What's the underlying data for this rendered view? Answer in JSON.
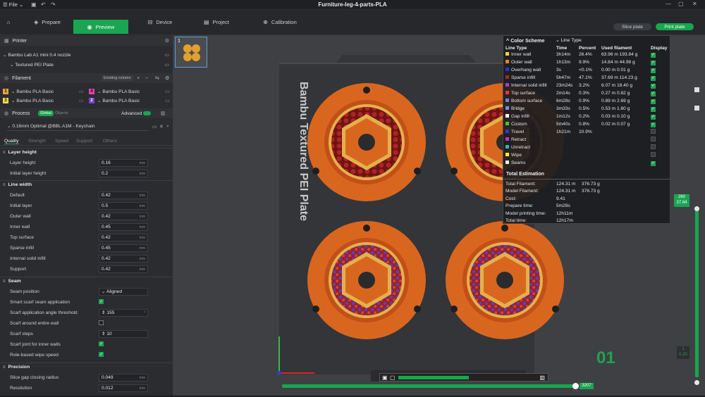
{
  "titlebar": {
    "menu": "☰ File ⌄",
    "title": "Furniture-leg-4-parts-PLA",
    "win_min": "—",
    "win_max": "▢",
    "win_close": "✕"
  },
  "nav": {
    "tabs": [
      {
        "label": "Prepare",
        "icon": "cube-icon"
      },
      {
        "label": "Preview",
        "icon": "eye-icon"
      },
      {
        "label": "Device",
        "icon": "device-icon"
      },
      {
        "label": "Project",
        "icon": "folder-icon"
      },
      {
        "label": "Calibration",
        "icon": "calibration-icon"
      }
    ],
    "slice_btn": "Slice plate",
    "print_btn": "Print plate"
  },
  "printer": {
    "section": "Printer",
    "name": "Bambu Lab A1 mini 0.4 nozzle",
    "plate": "Textured PEI Plate"
  },
  "filament": {
    "section": "Filament",
    "existing_btn": "Existing column",
    "items": [
      {
        "num": "1",
        "name": "Bambu PLA Basic",
        "color": "#e8a23a"
      },
      {
        "num": "2",
        "name": "Bambu PLA Basic",
        "color": "#7a3fd0"
      },
      {
        "num": "3",
        "name": "Bambu PLA Basic",
        "color": "#f5d642"
      },
      {
        "num": "4",
        "name": "Bambu PLA Basic",
        "color": "#e83ea6"
      }
    ]
  },
  "process": {
    "section": "Process",
    "global": "Global",
    "objects": "Objects",
    "advanced": "Advanced",
    "preset": "0.16mm Optimal @BBL A1M - Keychain",
    "tabs": [
      "Quality",
      "Strength",
      "Speed",
      "Support",
      "Others"
    ]
  },
  "settings": {
    "layer_height": {
      "title": "Layer height",
      "rows": [
        {
          "label": "Layer height",
          "value": "0.16",
          "unit": "mm"
        },
        {
          "label": "Initial layer height",
          "value": "0.2",
          "unit": "mm"
        }
      ]
    },
    "line_width": {
      "title": "Line width",
      "rows": [
        {
          "label": "Default",
          "value": "0.42",
          "unit": "mm"
        },
        {
          "label": "Initial layer",
          "value": "0.5",
          "unit": "mm"
        },
        {
          "label": "Outer wall",
          "value": "0.42",
          "unit": "mm"
        },
        {
          "label": "Inner wall",
          "value": "0.45",
          "unit": "mm"
        },
        {
          "label": "Top surface",
          "value": "0.42",
          "unit": "mm"
        },
        {
          "label": "Sparse infill",
          "value": "0.45",
          "unit": "mm"
        },
        {
          "label": "Internal solid infill",
          "value": "0.42",
          "unit": "mm"
        },
        {
          "label": "Support",
          "value": "0.42",
          "unit": "mm"
        }
      ]
    },
    "seam": {
      "title": "Seam",
      "position_label": "Seam position",
      "position_value": "Aligned",
      "smart_label": "Smart scarf seam application",
      "angle_label": "Scarf application angle threshold",
      "angle_value": "155",
      "angle_unit": "°",
      "entire_label": "Scarf around entire wall",
      "steps_label": "Scarf steps",
      "steps_value": "10",
      "inner_label": "Scarf joint for inner walls",
      "role_label": "Role-based wipe speed"
    },
    "precision": {
      "title": "Precision",
      "rows": [
        {
          "label": "Slice gap closing radius",
          "value": "0.049",
          "unit": "mm"
        },
        {
          "label": "Resolution",
          "value": "0.012",
          "unit": "mm"
        }
      ]
    }
  },
  "canvas": {
    "plate_text": "Bambu Textured PEI Plate",
    "plate_num": "01",
    "thumb_num": "1",
    "layer_top_1": "260",
    "layer_top_2": "37.64",
    "layer_bottom_1": "1",
    "layer_bottom_2": "0.20",
    "progress_label": "3207"
  },
  "color_scheme": {
    "title": "Color Scheme",
    "mode": "Line Type",
    "headers": [
      "Line Type",
      "Time",
      "Percent",
      "Used filament",
      "Display"
    ],
    "rows": [
      {
        "color": "#f5d23a",
        "name": "Inner wall",
        "time": "3h14m",
        "percent": "26.4%",
        "len": "63.96 m",
        "weight": "193.84 g",
        "display": true
      },
      {
        "color": "#ee7d2a",
        "name": "Outer wall",
        "time": "1h13m",
        "percent": "9.9%",
        "len": "14.84 m",
        "weight": "44.98 g",
        "display": true
      },
      {
        "color": "#2536d8",
        "name": "Overhang wall",
        "time": "3s",
        "percent": "<0.1%",
        "len": "0.00 m",
        "weight": "0.01 g",
        "display": true
      },
      {
        "color": "#a62828",
        "name": "Sparse infill",
        "time": "5h47m",
        "percent": "47.1%",
        "len": "37.69 m",
        "weight": "114.23 g",
        "display": true
      },
      {
        "color": "#a23cd6",
        "name": "Internal solid infill",
        "time": "23m24s",
        "percent": "3.2%",
        "len": "6.07 m",
        "weight": "18.40 g",
        "display": true
      },
      {
        "color": "#f0333b",
        "name": "Top surface",
        "time": "2m14s",
        "percent": "0.3%",
        "len": "0.27 m",
        "weight": "0.82 g",
        "display": true
      },
      {
        "color": "#6c7ee6",
        "name": "Bottom surface",
        "time": "6m28s",
        "percent": "0.9%",
        "len": "0.89 m",
        "weight": "2.69 g",
        "display": true
      },
      {
        "color": "#7a8ce8",
        "name": "Bridge",
        "time": "3m33s",
        "percent": "0.5%",
        "len": "0.53 m",
        "weight": "1.60 g",
        "display": true
      },
      {
        "color": "#ffffff",
        "name": "Gap infill",
        "time": "1m12s",
        "percent": "0.2%",
        "len": "0.03 m",
        "weight": "0.10 g",
        "display": true
      },
      {
        "color": "#40c63a",
        "name": "Custom",
        "time": "5m40s",
        "percent": "0.8%",
        "len": "0.02 m",
        "weight": "0.07 g",
        "display": true
      },
      {
        "color": "#2c3ad0",
        "name": "Travel",
        "time": "1h21m",
        "percent": "10.9%",
        "len": "",
        "weight": "",
        "display": false
      },
      {
        "color": "#d22bc9",
        "name": "Retract",
        "time": "",
        "percent": "",
        "len": "",
        "weight": "",
        "display": false
      },
      {
        "color": "#2fb4c4",
        "name": "Unretract",
        "time": "",
        "percent": "",
        "len": "",
        "weight": "",
        "display": false
      },
      {
        "color": "#f6f03a",
        "name": "Wipe",
        "time": "",
        "percent": "",
        "len": "",
        "weight": "",
        "display": false
      },
      {
        "color": "#ececec",
        "name": "Seams",
        "time": "",
        "percent": "",
        "len": "",
        "weight": "",
        "display": true
      }
    ]
  },
  "estimation": {
    "title": "Total Estimation",
    "rows": [
      {
        "label": "Total Filament:",
        "v1": "124.31 m",
        "v2": "376.73 g"
      },
      {
        "label": "Model Filament:",
        "v1": "124.31 m",
        "v2": "376.73 g"
      },
      {
        "label": "Cost:",
        "v1": "9.41",
        "v2": ""
      },
      {
        "label": "Prepare time:",
        "v1": "5m28s",
        "v2": ""
      },
      {
        "label": "Model printing time:",
        "v1": "12h11m",
        "v2": ""
      },
      {
        "label": "Total time:",
        "v1": "12h17m",
        "v2": ""
      }
    ]
  },
  "colors": {
    "accent": "#1aa550",
    "print_orange": "#d9661f",
    "infill_red": "#9a2020"
  }
}
